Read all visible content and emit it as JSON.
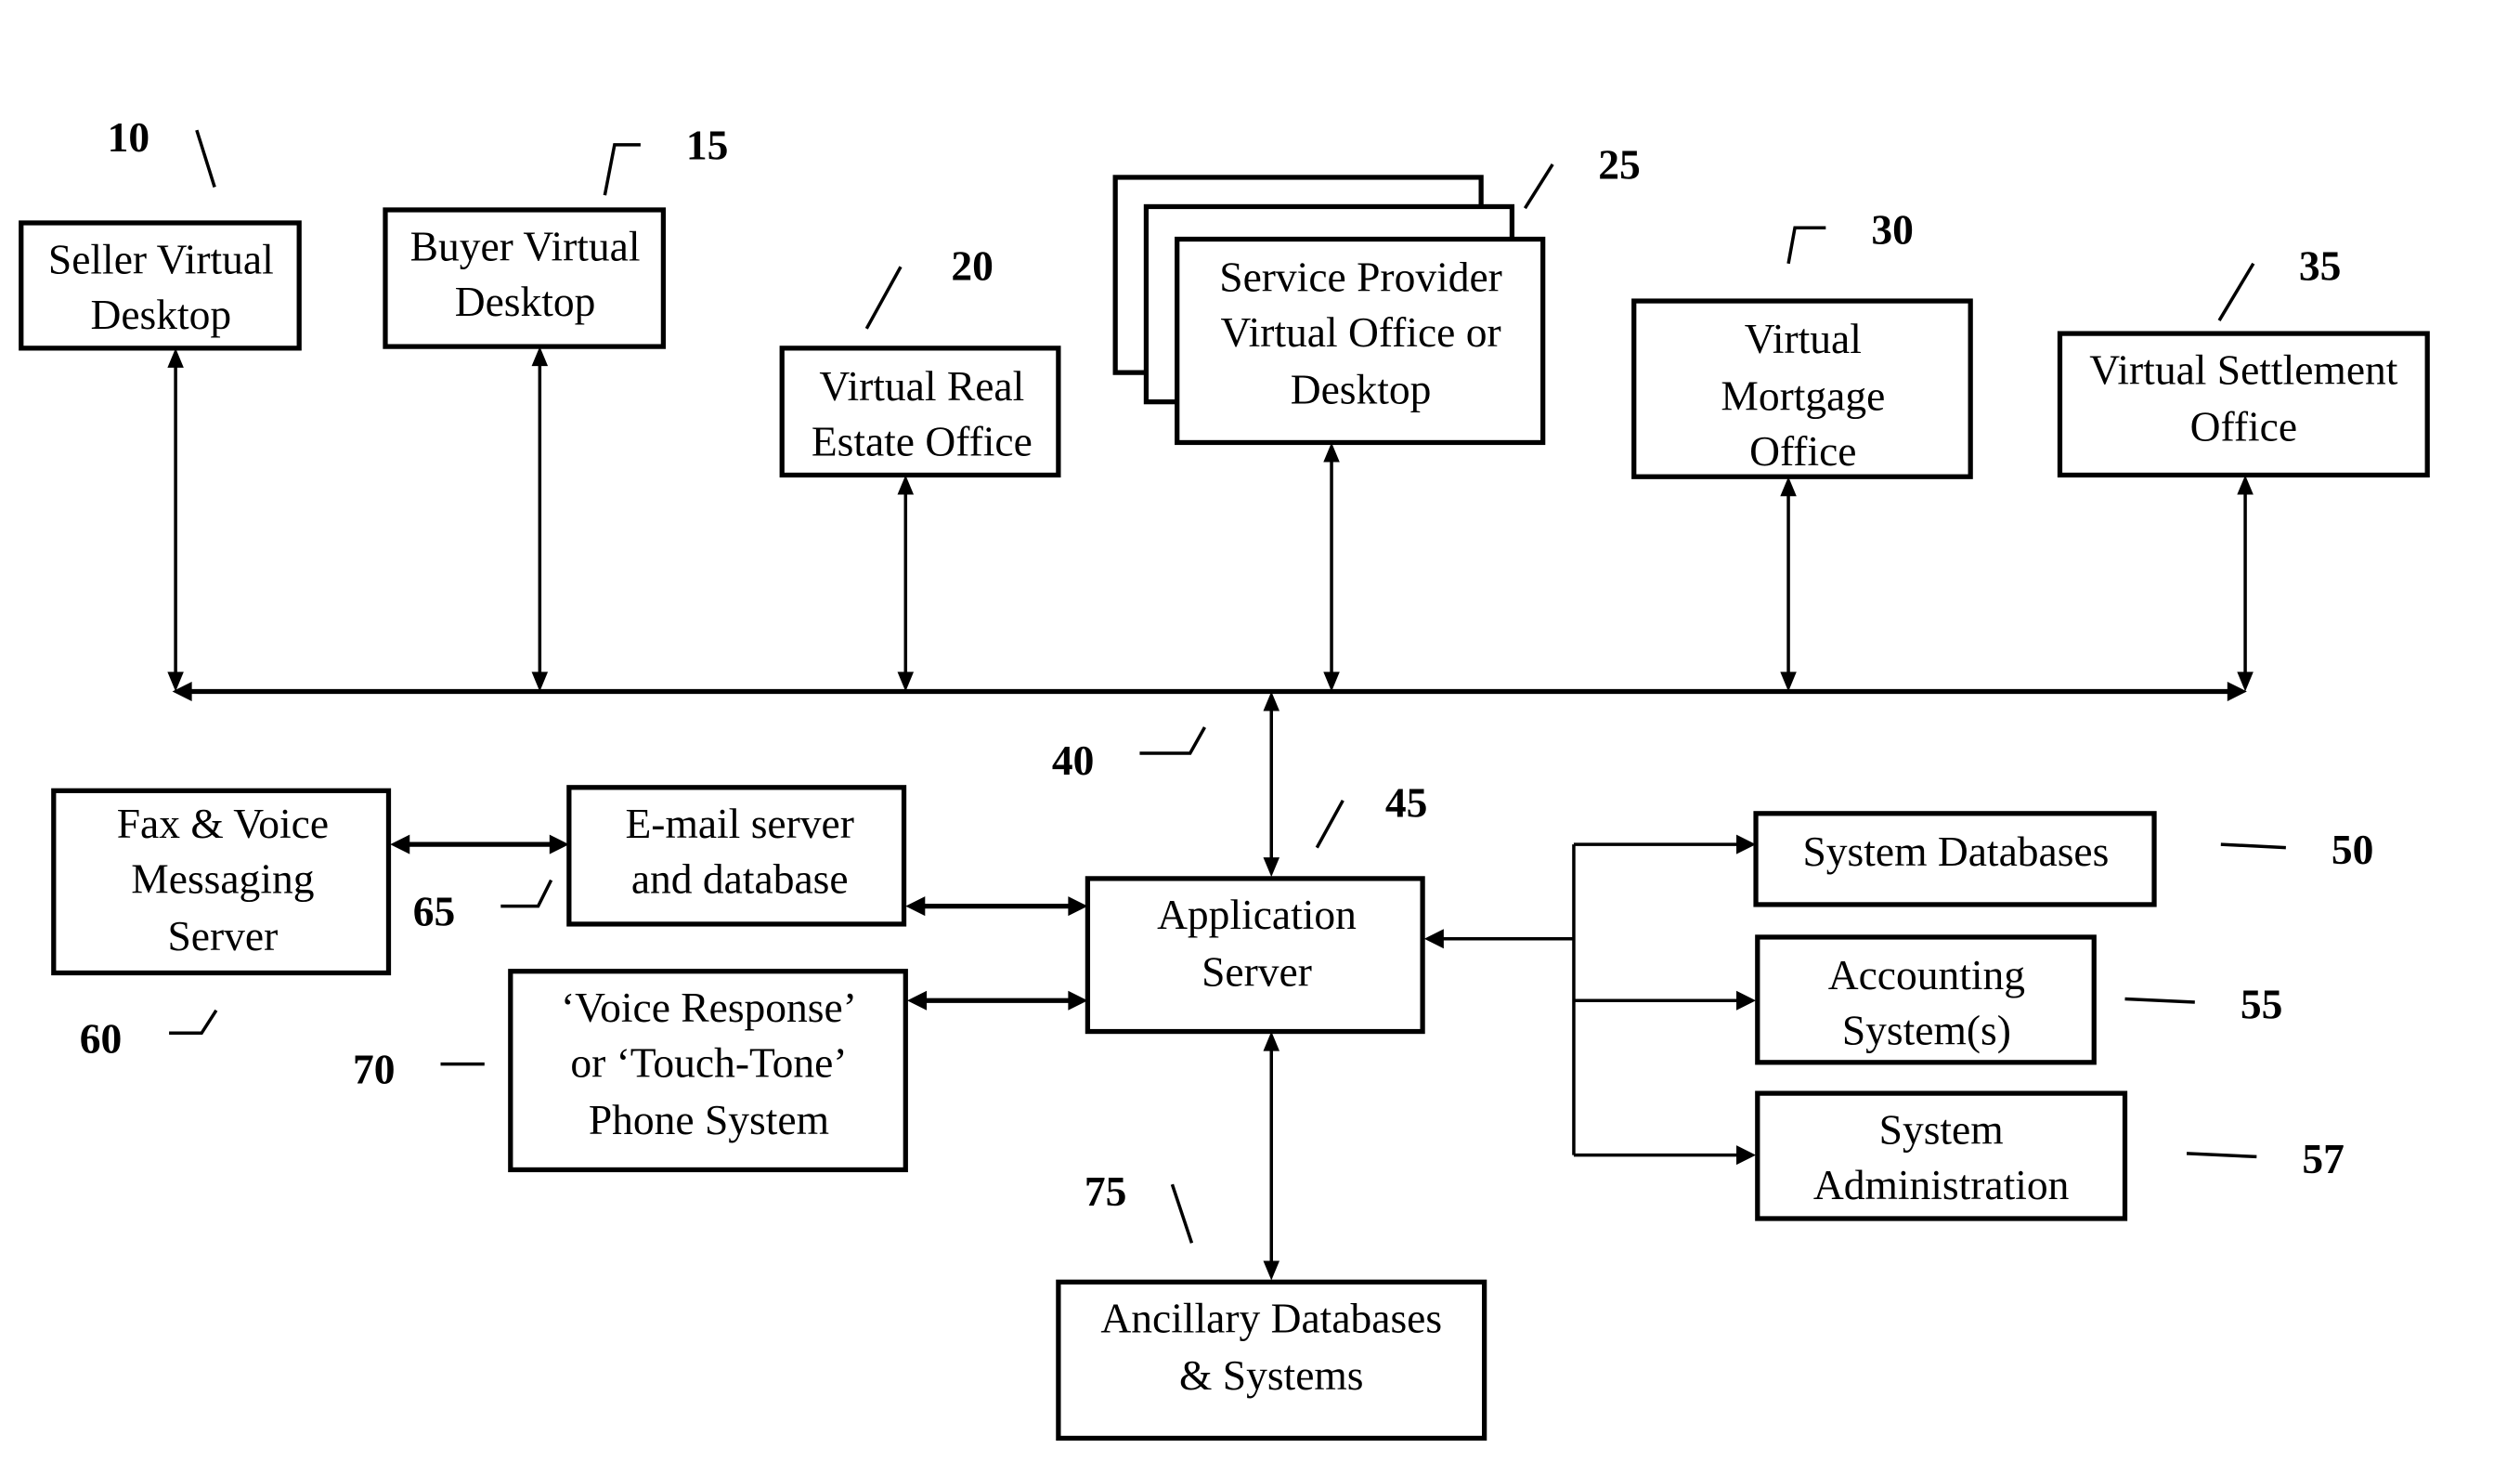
{
  "figure": {
    "nodes": [
      {
        "id": "seller",
        "ref": "10",
        "lines": [
          "Seller Virtual",
          "Desktop"
        ]
      },
      {
        "id": "buyer",
        "ref": "15",
        "lines": [
          "Buyer Virtual",
          "Desktop"
        ]
      },
      {
        "id": "real-estate",
        "ref": "20",
        "lines": [
          "Virtual Real",
          "Estate Office"
        ]
      },
      {
        "id": "service-provider",
        "ref": "25",
        "lines": [
          "Service Provider",
          "Virtual Office or",
          "Desktop"
        ]
      },
      {
        "id": "mortgage",
        "ref": "30",
        "lines": [
          "Virtual",
          "Mortgage",
          "Office"
        ]
      },
      {
        "id": "settlement",
        "ref": "35",
        "lines": [
          "Virtual Settlement",
          "Office"
        ]
      },
      {
        "id": "network",
        "ref": "40",
        "lines": []
      },
      {
        "id": "app-server",
        "ref": "45",
        "lines": [
          "Application",
          "Server"
        ]
      },
      {
        "id": "system-db",
        "ref": "50",
        "lines": [
          "System Databases"
        ]
      },
      {
        "id": "accounting",
        "ref": "55",
        "lines": [
          "Accounting",
          "System(s)"
        ]
      },
      {
        "id": "sys-admin",
        "ref": "57",
        "lines": [
          "System",
          "Administration"
        ]
      },
      {
        "id": "fax-voice",
        "ref": "60",
        "lines": [
          "Fax & Voice",
          "Messaging",
          "Server"
        ]
      },
      {
        "id": "email",
        "ref": "65",
        "lines": [
          "E-mail server",
          "and database"
        ]
      },
      {
        "id": "voice-response",
        "ref": "70",
        "lines": [
          "‘Voice Response’",
          "or ‘Touch-Tone’",
          "Phone System"
        ]
      },
      {
        "id": "ancillary",
        "ref": "75",
        "lines": [
          "Ancillary Databases",
          "& Systems"
        ]
      }
    ],
    "edges": [
      {
        "from": "seller",
        "to": "network",
        "type": "bidirectional"
      },
      {
        "from": "buyer",
        "to": "network",
        "type": "bidirectional"
      },
      {
        "from": "real-estate",
        "to": "network",
        "type": "bidirectional"
      },
      {
        "from": "service-provider",
        "to": "network",
        "type": "bidirectional"
      },
      {
        "from": "mortgage",
        "to": "network",
        "type": "bidirectional"
      },
      {
        "from": "settlement",
        "to": "network",
        "type": "bidirectional"
      },
      {
        "from": "network",
        "to": "app-server",
        "type": "bidirectional"
      },
      {
        "from": "fax-voice",
        "to": "email",
        "type": "bidirectional"
      },
      {
        "from": "email",
        "to": "app-server",
        "type": "bidirectional"
      },
      {
        "from": "voice-response",
        "to": "app-server",
        "type": "bidirectional"
      },
      {
        "from": "app-server",
        "to": "ancillary",
        "type": "bidirectional"
      },
      {
        "from": "app-server",
        "to": "system-db",
        "type": "bidirectional"
      },
      {
        "from": "app-server",
        "to": "accounting",
        "type": "bidirectional"
      },
      {
        "from": "app-server",
        "to": "sys-admin",
        "type": "bidirectional"
      }
    ]
  }
}
